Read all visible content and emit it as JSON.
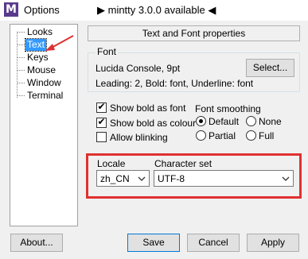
{
  "window": {
    "title": "Options",
    "status": "▶ mintty 3.0.0 available ◀",
    "app_icon_letter": "M"
  },
  "sidebar": {
    "items": [
      {
        "label": "Looks"
      },
      {
        "label": "Text"
      },
      {
        "label": "Keys"
      },
      {
        "label": "Mouse"
      },
      {
        "label": "Window"
      },
      {
        "label": "Terminal"
      }
    ],
    "selected": "Text"
  },
  "header": {
    "label": "Text and Font properties"
  },
  "font": {
    "group_label": "Font",
    "name": "Lucida Console, 9pt",
    "select_label": "Select...",
    "details": "Leading: 2, Bold: font, Underline: font"
  },
  "options": {
    "show_bold_as_font": {
      "label": "Show bold as font",
      "checked": true
    },
    "show_bold_as_colour": {
      "label": "Show bold as colour",
      "checked": true
    },
    "allow_blinking": {
      "label": "Allow blinking",
      "checked": false
    }
  },
  "smoothing": {
    "group_label": "Font smoothing",
    "options": [
      {
        "label": "Default",
        "selected": true
      },
      {
        "label": "None",
        "selected": false
      },
      {
        "label": "Partial",
        "selected": false
      },
      {
        "label": "Full",
        "selected": false
      }
    ]
  },
  "locale": {
    "label": "Locale",
    "value": "zh_CN"
  },
  "charset": {
    "label": "Character set",
    "value": "UTF-8"
  },
  "footer": {
    "about_label": "About...",
    "save_label": "Save",
    "cancel_label": "Cancel",
    "apply_label": "Apply"
  },
  "colors": {
    "highlight": "#3399ff",
    "annotation_red": "#e03030"
  }
}
